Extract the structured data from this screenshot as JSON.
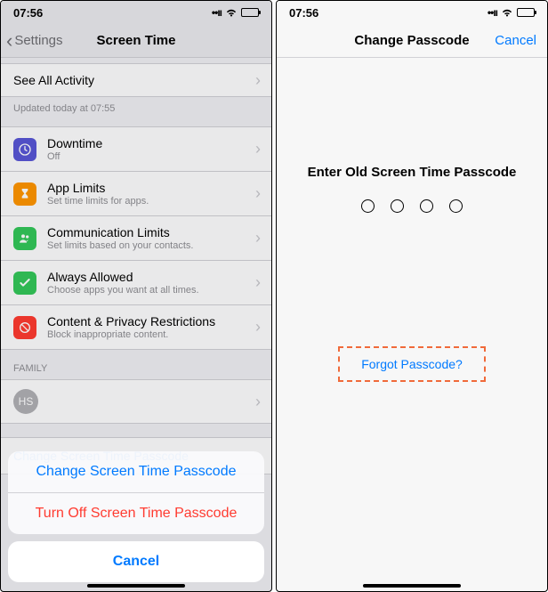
{
  "status": {
    "time": "07:56"
  },
  "left": {
    "nav": {
      "back": "Settings",
      "title": "Screen Time"
    },
    "seeAll": "See All Activity",
    "updated": "Updated today at 07:55",
    "items": [
      {
        "title": "Downtime",
        "sub": "Off"
      },
      {
        "title": "App Limits",
        "sub": "Set time limits for apps."
      },
      {
        "title": "Communication Limits",
        "sub": "Set limits based on your contacts."
      },
      {
        "title": "Always Allowed",
        "sub": "Choose apps you want at all times."
      },
      {
        "title": "Content & Privacy Restrictions",
        "sub": "Block inappropriate content."
      }
    ],
    "familyHeader": "FAMILY",
    "familyInitials": "HS",
    "changePasscode": "Change Screen Time Passcode",
    "sheet": {
      "change": "Change Screen Time Passcode",
      "turnoff": "Turn Off Screen Time Passcode",
      "cancel": "Cancel"
    }
  },
  "right": {
    "nav": {
      "title": "Change Passcode",
      "cancel": "Cancel"
    },
    "prompt": "Enter Old Screen Time Passcode",
    "forgot": "Forgot Passcode?"
  }
}
